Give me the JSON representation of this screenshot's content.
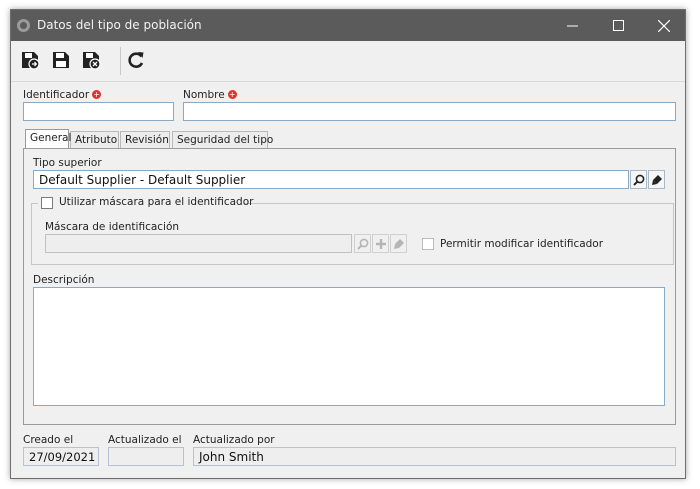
{
  "window": {
    "title": "Datos del tipo de población"
  },
  "toolbar": {
    "buttons": [
      {
        "icon": "save-new-icon"
      },
      {
        "icon": "save-icon"
      },
      {
        "icon": "save-close-icon"
      },
      {
        "icon": "refresh-icon"
      }
    ]
  },
  "fields": {
    "identificador": {
      "label": "Identificador",
      "value": ""
    },
    "nombre": {
      "label": "Nombre",
      "value": ""
    }
  },
  "tabs": [
    {
      "label": "General",
      "active": true
    },
    {
      "label": "Atributo",
      "active": false
    },
    {
      "label": "Revisión",
      "active": false
    },
    {
      "label": "Seguridad del tipo",
      "active": false
    }
  ],
  "general": {
    "tipo_superior": {
      "label": "Tipo superior",
      "value": "Default Supplier - Default Supplier"
    },
    "usar_mascara": {
      "label": "Utilizar máscara para el identificador",
      "checked": false
    },
    "mascara": {
      "label": "Máscara de identificación",
      "value": ""
    },
    "permitir_modificar": {
      "label": "Permitir modificar identificador",
      "checked": false
    },
    "descripcion": {
      "label": "Descripción",
      "value": ""
    }
  },
  "footer": {
    "creado_el": {
      "label": "Creado el",
      "value": "27/09/2021"
    },
    "actualizado_el": {
      "label": "Actualizado el",
      "value": ""
    },
    "actualizado_por": {
      "label": "Actualizado por",
      "value": "John Smith"
    }
  },
  "colors": {
    "titlebar": "#5b5b5b",
    "required": "#e03030",
    "input_border": "#8aa9c6"
  }
}
